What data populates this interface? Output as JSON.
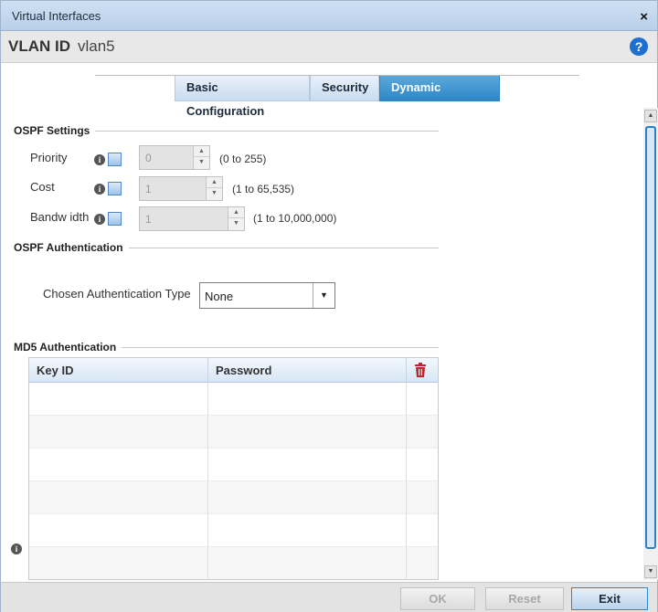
{
  "window": {
    "title": "Virtual Interfaces",
    "close": "×"
  },
  "vlan": {
    "label": "VLAN ID",
    "value": "vlan5",
    "help": "?"
  },
  "tabs": [
    {
      "label": "Basic Configuration"
    },
    {
      "label": "Security"
    },
    {
      "label": "Dynamic Routing"
    }
  ],
  "ospf": {
    "title": "OSPF Settings",
    "fields": [
      {
        "label": "Priority",
        "value": "0",
        "range": "(0 to 255)"
      },
      {
        "label": "Cost",
        "value": "1",
        "range": "(1 to 65,535)"
      },
      {
        "label": "Bandw idth",
        "value": "1",
        "range": "(1 to 10,000,000)"
      }
    ]
  },
  "auth": {
    "title": "OSPF Authentication",
    "type_label": "Chosen Authentication Type",
    "type_value": "None"
  },
  "md5": {
    "title": "MD5 Authentication",
    "columns": [
      "Key ID",
      "Password"
    ]
  },
  "footer": {
    "ok": "OK",
    "reset": "Reset",
    "exit": "Exit"
  }
}
